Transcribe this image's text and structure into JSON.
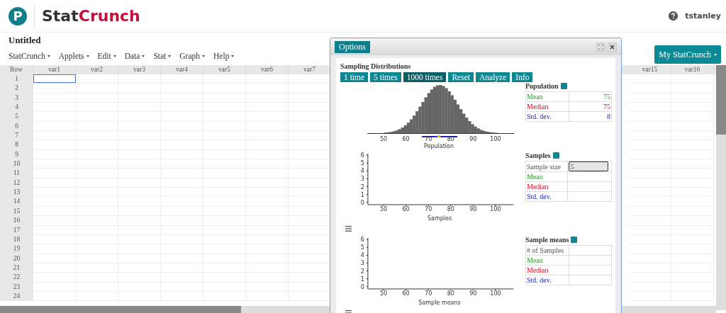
{
  "header": {
    "logo_mark": "P",
    "logo_text": "Stat**Crunch**",
    "username": "tstanley"
  },
  "document": {
    "title": "Untitled",
    "my_button": "My StatCrunch"
  },
  "menu": [
    "StatCrunch",
    "Applets",
    "Edit",
    "Data",
    "Stat",
    "Graph",
    "Help"
  ],
  "grid": {
    "row_header": "Row",
    "columns_left": [
      "var1",
      "var2",
      "var3",
      "var4",
      "var5",
      "var6",
      "var7"
    ],
    "columns_right": [
      "var15",
      "var16"
    ],
    "rows": [
      "1",
      "2",
      "3",
      "4",
      "5",
      "6",
      "7",
      "8",
      "9",
      "10",
      "11",
      "12",
      "13",
      "14",
      "15",
      "16",
      "17",
      "18",
      "19",
      "20",
      "21",
      "22",
      "23",
      "24"
    ]
  },
  "dialog": {
    "options_button": "Options",
    "heading": "Sampling Distributions",
    "buttons": [
      {
        "label": "1 time",
        "selected": false
      },
      {
        "label": "5 times",
        "selected": false
      },
      {
        "label": "1000 times",
        "selected": true
      },
      {
        "label": "Reset",
        "selected": false
      },
      {
        "label": "Analyze",
        "selected": false
      },
      {
        "label": "Info",
        "selected": false
      }
    ],
    "population_plot": {
      "xlabel": "Population",
      "xticks": [
        "50",
        "60",
        "70",
        "80",
        "90",
        "100"
      ]
    },
    "samples_plot": {
      "chart_data": {
        "type": "bar",
        "xlabel": "Samples",
        "xlim": [
          43,
          108
        ],
        "ylim": [
          -0.3,
          6.2
        ],
        "xticks": [
          50,
          60,
          70,
          80,
          90,
          100
        ],
        "yticks": [
          0,
          1,
          2,
          3,
          4,
          5,
          6
        ]
      }
    },
    "sample_means_plot": {
      "chart_data": {
        "type": "bar",
        "xlabel": "Sample means",
        "xlim": [
          43,
          108
        ],
        "ylim": [
          -0.3,
          6.2
        ],
        "xticks": [
          50,
          60,
          70,
          80,
          90,
          100
        ],
        "yticks": [
          0,
          1,
          2,
          3,
          4,
          5,
          6
        ]
      }
    },
    "population_table": {
      "title": "Population",
      "rows": [
        {
          "kind": "mean",
          "label": "Mean",
          "value": "75"
        },
        {
          "kind": "median",
          "label": "Median",
          "value": "75"
        },
        {
          "kind": "sd",
          "label": "Std. dev.",
          "value": "8"
        }
      ]
    },
    "samples_table": {
      "title": "Samples",
      "rows": [
        {
          "kind": "input",
          "label": "Sample size",
          "value": "5"
        },
        {
          "kind": "mean",
          "label": "Mean"
        },
        {
          "kind": "median",
          "label": "Median"
        },
        {
          "kind": "sd",
          "label": "Std. dev."
        }
      ]
    },
    "sample_means_table": {
      "title": "Sample means",
      "rows": [
        {
          "kind": "plain",
          "label": "# of Samples"
        },
        {
          "kind": "mean",
          "label": "Mean"
        },
        {
          "kind": "median",
          "label": "Median"
        },
        {
          "kind": "sd",
          "label": "Std. dev."
        }
      ]
    }
  }
}
